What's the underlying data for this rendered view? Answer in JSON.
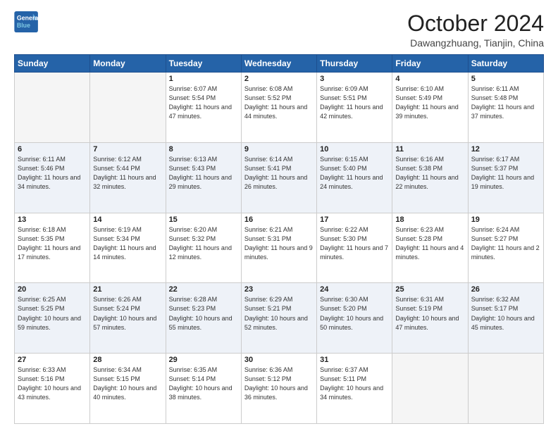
{
  "header": {
    "logo_line1": "General",
    "logo_line2": "Blue",
    "month": "October 2024",
    "location": "Dawangzhuang, Tianjin, China"
  },
  "days_of_week": [
    "Sunday",
    "Monday",
    "Tuesday",
    "Wednesday",
    "Thursday",
    "Friday",
    "Saturday"
  ],
  "weeks": [
    [
      {
        "day": "",
        "detail": ""
      },
      {
        "day": "",
        "detail": ""
      },
      {
        "day": "1",
        "detail": "Sunrise: 6:07 AM\nSunset: 5:54 PM\nDaylight: 11 hours and 47 minutes."
      },
      {
        "day": "2",
        "detail": "Sunrise: 6:08 AM\nSunset: 5:52 PM\nDaylight: 11 hours and 44 minutes."
      },
      {
        "day": "3",
        "detail": "Sunrise: 6:09 AM\nSunset: 5:51 PM\nDaylight: 11 hours and 42 minutes."
      },
      {
        "day": "4",
        "detail": "Sunrise: 6:10 AM\nSunset: 5:49 PM\nDaylight: 11 hours and 39 minutes."
      },
      {
        "day": "5",
        "detail": "Sunrise: 6:11 AM\nSunset: 5:48 PM\nDaylight: 11 hours and 37 minutes."
      }
    ],
    [
      {
        "day": "6",
        "detail": "Sunrise: 6:11 AM\nSunset: 5:46 PM\nDaylight: 11 hours and 34 minutes."
      },
      {
        "day": "7",
        "detail": "Sunrise: 6:12 AM\nSunset: 5:44 PM\nDaylight: 11 hours and 32 minutes."
      },
      {
        "day": "8",
        "detail": "Sunrise: 6:13 AM\nSunset: 5:43 PM\nDaylight: 11 hours and 29 minutes."
      },
      {
        "day": "9",
        "detail": "Sunrise: 6:14 AM\nSunset: 5:41 PM\nDaylight: 11 hours and 26 minutes."
      },
      {
        "day": "10",
        "detail": "Sunrise: 6:15 AM\nSunset: 5:40 PM\nDaylight: 11 hours and 24 minutes."
      },
      {
        "day": "11",
        "detail": "Sunrise: 6:16 AM\nSunset: 5:38 PM\nDaylight: 11 hours and 22 minutes."
      },
      {
        "day": "12",
        "detail": "Sunrise: 6:17 AM\nSunset: 5:37 PM\nDaylight: 11 hours and 19 minutes."
      }
    ],
    [
      {
        "day": "13",
        "detail": "Sunrise: 6:18 AM\nSunset: 5:35 PM\nDaylight: 11 hours and 17 minutes."
      },
      {
        "day": "14",
        "detail": "Sunrise: 6:19 AM\nSunset: 5:34 PM\nDaylight: 11 hours and 14 minutes."
      },
      {
        "day": "15",
        "detail": "Sunrise: 6:20 AM\nSunset: 5:32 PM\nDaylight: 11 hours and 12 minutes."
      },
      {
        "day": "16",
        "detail": "Sunrise: 6:21 AM\nSunset: 5:31 PM\nDaylight: 11 hours and 9 minutes."
      },
      {
        "day": "17",
        "detail": "Sunrise: 6:22 AM\nSunset: 5:30 PM\nDaylight: 11 hours and 7 minutes."
      },
      {
        "day": "18",
        "detail": "Sunrise: 6:23 AM\nSunset: 5:28 PM\nDaylight: 11 hours and 4 minutes."
      },
      {
        "day": "19",
        "detail": "Sunrise: 6:24 AM\nSunset: 5:27 PM\nDaylight: 11 hours and 2 minutes."
      }
    ],
    [
      {
        "day": "20",
        "detail": "Sunrise: 6:25 AM\nSunset: 5:25 PM\nDaylight: 10 hours and 59 minutes."
      },
      {
        "day": "21",
        "detail": "Sunrise: 6:26 AM\nSunset: 5:24 PM\nDaylight: 10 hours and 57 minutes."
      },
      {
        "day": "22",
        "detail": "Sunrise: 6:28 AM\nSunset: 5:23 PM\nDaylight: 10 hours and 55 minutes."
      },
      {
        "day": "23",
        "detail": "Sunrise: 6:29 AM\nSunset: 5:21 PM\nDaylight: 10 hours and 52 minutes."
      },
      {
        "day": "24",
        "detail": "Sunrise: 6:30 AM\nSunset: 5:20 PM\nDaylight: 10 hours and 50 minutes."
      },
      {
        "day": "25",
        "detail": "Sunrise: 6:31 AM\nSunset: 5:19 PM\nDaylight: 10 hours and 47 minutes."
      },
      {
        "day": "26",
        "detail": "Sunrise: 6:32 AM\nSunset: 5:17 PM\nDaylight: 10 hours and 45 minutes."
      }
    ],
    [
      {
        "day": "27",
        "detail": "Sunrise: 6:33 AM\nSunset: 5:16 PM\nDaylight: 10 hours and 43 minutes."
      },
      {
        "day": "28",
        "detail": "Sunrise: 6:34 AM\nSunset: 5:15 PM\nDaylight: 10 hours and 40 minutes."
      },
      {
        "day": "29",
        "detail": "Sunrise: 6:35 AM\nSunset: 5:14 PM\nDaylight: 10 hours and 38 minutes."
      },
      {
        "day": "30",
        "detail": "Sunrise: 6:36 AM\nSunset: 5:12 PM\nDaylight: 10 hours and 36 minutes."
      },
      {
        "day": "31",
        "detail": "Sunrise: 6:37 AM\nSunset: 5:11 PM\nDaylight: 10 hours and 34 minutes."
      },
      {
        "day": "",
        "detail": ""
      },
      {
        "day": "",
        "detail": ""
      }
    ]
  ]
}
